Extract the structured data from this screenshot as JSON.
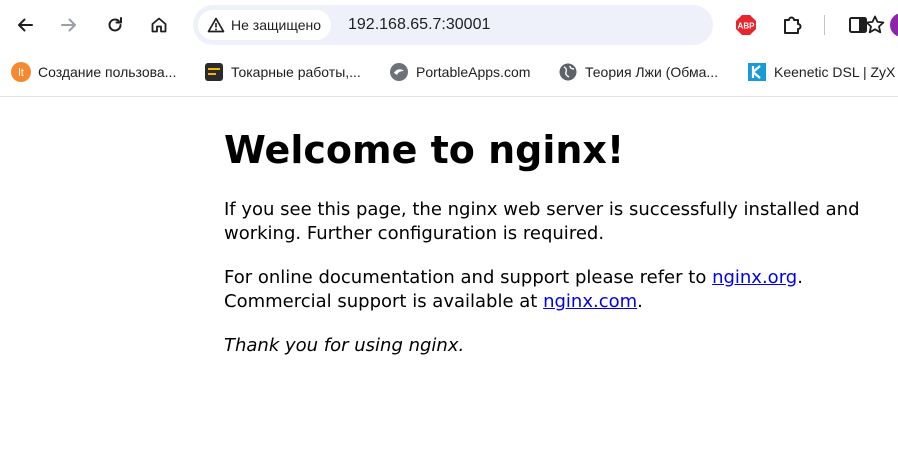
{
  "browser": {
    "security_label": "Не защищено",
    "url": "192.168.65.7:30001",
    "extension_badge": "ABP",
    "colors": {
      "toolbar_bg": "#ffffff",
      "omnibox_bg": "#eef1f9",
      "profile": "#8e24aa",
      "abp_red": "#e5262d"
    }
  },
  "bookmarks": [
    {
      "label": "Создание пользова...",
      "icon": "lt-orange-icon"
    },
    {
      "label": "Токарные работы,...",
      "icon": "lathe-icon"
    },
    {
      "label": "PortableApps.com",
      "icon": "portableapps-icon"
    },
    {
      "label": "Теория Лжи (Обма...",
      "icon": "globe-icon"
    },
    {
      "label": "Keenetic DSL | ZyX",
      "icon": "keenetic-icon"
    }
  ],
  "page": {
    "heading": "Welcome to nginx!",
    "p1": "If you see this page, the nginx web server is successfully installed and working. Further configuration is required.",
    "p2_before_link1": "For online documentation and support please refer to ",
    "link1": "nginx.org",
    "p2_after_link1": ".",
    "p2_line2_before": "Commercial support is available at ",
    "link2": "nginx.com",
    "p2_line2_after": ".",
    "thanks": "Thank you for using nginx."
  }
}
